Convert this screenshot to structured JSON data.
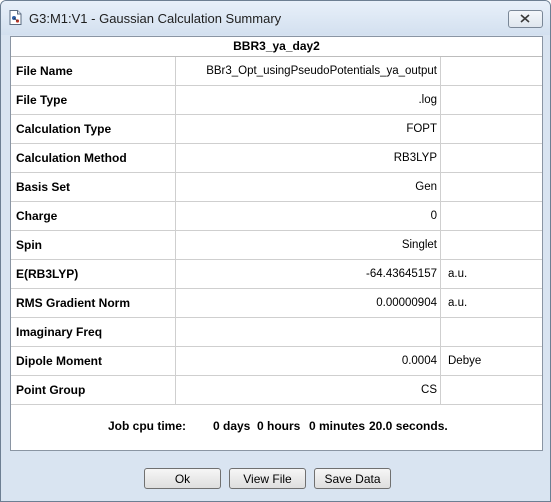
{
  "window": {
    "title": "G3:M1:V1 - Gaussian Calculation Summary",
    "close_icon": "close-icon",
    "app_icon": "gaussview-document-icon"
  },
  "summary": {
    "header": "BBR3_ya_day2",
    "rows": [
      {
        "label": "File Name",
        "value": "BBr3_Opt_usingPseudoPotentials_ya_output",
        "unit": ""
      },
      {
        "label": "File Type",
        "value": ".log",
        "unit": ""
      },
      {
        "label": "Calculation Type",
        "value": "FOPT",
        "unit": ""
      },
      {
        "label": "Calculation Method",
        "value": "RB3LYP",
        "unit": ""
      },
      {
        "label": "Basis Set",
        "value": "Gen",
        "unit": ""
      },
      {
        "label": "Charge",
        "value": "0",
        "unit": ""
      },
      {
        "label": "Spin",
        "value": "Singlet",
        "unit": ""
      },
      {
        "label": "E(RB3LYP)",
        "value": "-64.43645157",
        "unit": "a.u."
      },
      {
        "label": "RMS Gradient Norm",
        "value": "0.00000904",
        "unit": "a.u."
      },
      {
        "label": "Imaginary Freq",
        "value": "",
        "unit": ""
      },
      {
        "label": "Dipole Moment",
        "value": "0.0004",
        "unit": "Debye"
      },
      {
        "label": "Point Group",
        "value": "CS",
        "unit": ""
      }
    ],
    "cpu_time": {
      "label": "Job cpu time:",
      "days": "0 days",
      "hours": "0 hours",
      "minutes": "0 minutes",
      "seconds": "20.0 seconds."
    }
  },
  "buttons": {
    "ok": "Ok",
    "view_file": "View File",
    "save_data": "Save Data"
  }
}
